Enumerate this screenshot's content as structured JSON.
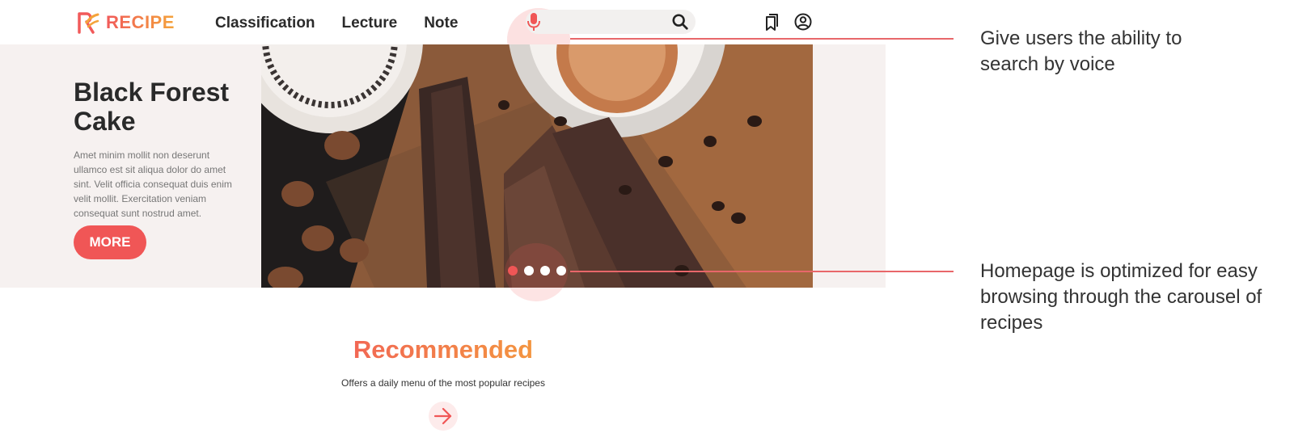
{
  "app": {
    "logo_text": "RECIPE",
    "brand_colors": {
      "primary": "#f05656",
      "secondary": "#f4a33a"
    }
  },
  "nav": {
    "items": [
      {
        "label": "Classification"
      },
      {
        "label": "Lecture"
      },
      {
        "label": "Note"
      }
    ]
  },
  "header_icons": [
    "microphone-icon",
    "search-icon",
    "bookmark-icon",
    "user-icon"
  ],
  "hero": {
    "title": "Black Forest Cake",
    "description": "Amet minim mollit non deserunt ullamco est sit aliqua dolor do amet sint. Velit officia consequat duis enim velit mollit. Exercitation veniam consequat sunt nostrud amet.",
    "button_label": "MORE",
    "carousel": {
      "slide_count": 4,
      "active_index": 0
    }
  },
  "callouts": {
    "voice_search": "Give users the ability to search by voice",
    "carousel": "Homepage is optimized for easy browsing through the carousel of recipes"
  },
  "recommended": {
    "title": "Recommended",
    "subtitle": "Offers a daily menu of the most popular recipes"
  }
}
